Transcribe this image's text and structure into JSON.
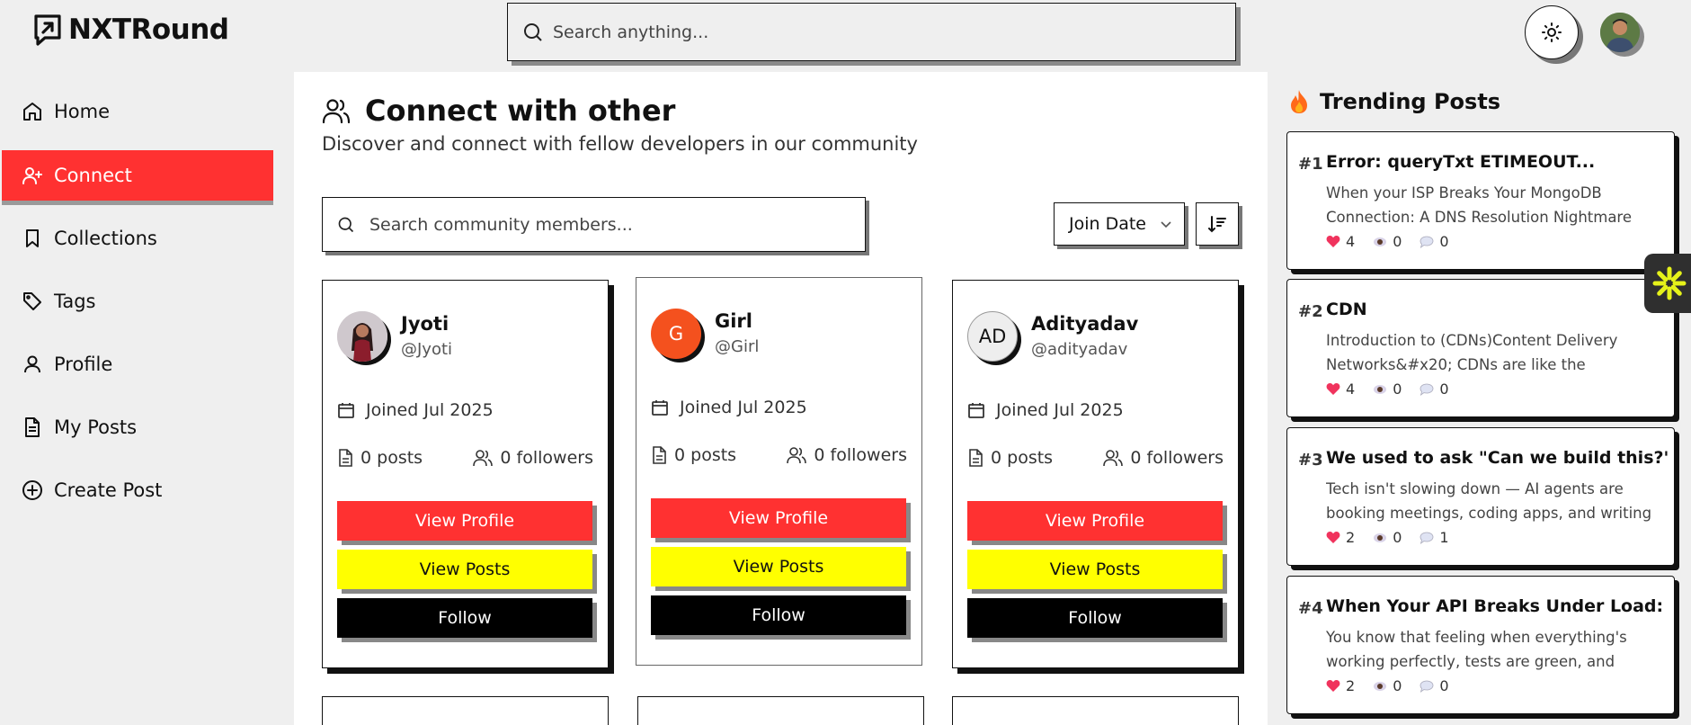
{
  "app": {
    "name": "NXTRound",
    "search_placeholder": "Search anything..."
  },
  "sidebar": {
    "items": [
      {
        "label": "Home",
        "icon": "home-icon"
      },
      {
        "label": "Connect",
        "icon": "user-plus-icon",
        "active": true
      },
      {
        "label": "Collections",
        "icon": "bookmark-icon"
      },
      {
        "label": "Tags",
        "icon": "tag-icon"
      },
      {
        "label": "Profile",
        "icon": "user-icon"
      },
      {
        "label": "My Posts",
        "icon": "file-text-icon"
      },
      {
        "label": "Create Post",
        "icon": "plus-circle-icon"
      }
    ]
  },
  "main": {
    "title": "Connect with other",
    "subtitle": "Discover and connect with fellow developers in our community",
    "search_placeholder": "Search community members...",
    "sort_label": "Join Date"
  },
  "members": [
    {
      "name": "Jyoti",
      "handle": "@Jyoti",
      "avatar_type": "photo",
      "joined": "Joined Jul 2025",
      "posts": "0 posts",
      "followers": "0 followers"
    },
    {
      "name": "Girl",
      "handle": "@Girl",
      "avatar_type": "initial",
      "avatar_text": "G",
      "avatar_color": "#f4511e",
      "joined": "Joined Jul 2025",
      "posts": "0 posts",
      "followers": "0 followers"
    },
    {
      "name": "Adityadav",
      "handle": "@adityadav",
      "avatar_type": "initial",
      "avatar_text": "AD",
      "avatar_color": "#eeeeee",
      "joined": "Joined Jul 2025",
      "posts": "0 posts",
      "followers": "0 followers"
    }
  ],
  "card_buttons": {
    "view_profile": "View Profile",
    "view_posts": "View Posts",
    "follow": "Follow"
  },
  "trending": {
    "title": "Trending Posts",
    "posts": [
      {
        "rank": "#1",
        "title": "Error: queryTxt ETIMEOUT...",
        "excerpt": "When your ISP Breaks Your MongoDB Connection: A DNS Resolution Nightmare Picture this: It's a...",
        "likes": "4",
        "views": "0",
        "comments": "0"
      },
      {
        "rank": "#2",
        "title": "CDN",
        "excerpt": "Introduction to (CDNs)Content Delivery Networks&#x20; CDNs are like the internet's...",
        "likes": "4",
        "views": "0",
        "comments": "0"
      },
      {
        "rank": "#3",
        "title": "We used to ask \"Can we build this?\" Now...",
        "excerpt": "Tech isn't slowing down — AI agents are booking meetings, coding apps, and writing laws. The re...",
        "likes": "2",
        "views": "0",
        "comments": "1"
      },
      {
        "rank": "#4",
        "title": "When Your API Breaks Under Load: A...",
        "excerpt": "You know that feeling when everything's working perfectly, tests are green, and you're feeling...",
        "likes": "2",
        "views": "0",
        "comments": "0"
      }
    ]
  },
  "colors": {
    "accent_red": "#ff3131",
    "accent_yellow": "#ffff00",
    "background": "#efefef"
  }
}
